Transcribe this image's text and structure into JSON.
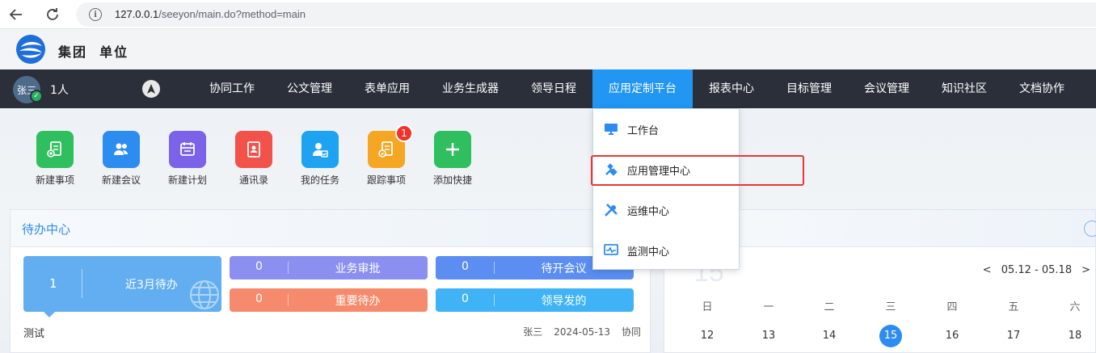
{
  "browser": {
    "url_host": "127.0.0.1",
    "url_path": "/seeyon/main.do?method=main"
  },
  "header": {
    "org_group": "集团",
    "org_unit": "单位"
  },
  "user": {
    "avatar_text": "张三",
    "online_count": "1人"
  },
  "nav": {
    "items": [
      "协同工作",
      "公文管理",
      "表单应用",
      "业务生成器",
      "领导日程",
      "应用定制平台",
      "报表中心",
      "目标管理",
      "会议管理",
      "知识社区",
      "文档协作"
    ],
    "active": "应用定制平台"
  },
  "dropdown": {
    "items": [
      "工作台",
      "应用管理中心",
      "运维中心",
      "监测中心"
    ],
    "highlighted": "应用管理中心"
  },
  "quick_actions": [
    {
      "label": "新建事项",
      "color": "#2fbf5f"
    },
    {
      "label": "新建会议",
      "color": "#2d8cf0"
    },
    {
      "label": "新建计划",
      "color": "#7b62e8"
    },
    {
      "label": "通讯录",
      "color": "#f2524a"
    },
    {
      "label": "我的任务",
      "color": "#1ea3f2"
    },
    {
      "label": "跟踪事项",
      "color": "#f5a623",
      "badge": "1"
    },
    {
      "label": "添加快捷",
      "color": "#2fbf5f"
    }
  ],
  "todo": {
    "title": "待办中心",
    "big_stat": {
      "count": "1",
      "label": "近3月待办"
    },
    "stats": [
      {
        "count": "0",
        "label": "业务审批",
        "color": "#8b8ff0"
      },
      {
        "count": "0",
        "label": "待开会议",
        "color": "#5b8ef0"
      },
      {
        "count": "0",
        "label": "重要待办",
        "color": "#f58b6c"
      },
      {
        "count": "0",
        "label": "领导发的",
        "color": "#3fb3f5"
      }
    ],
    "row": {
      "title": "测试",
      "sender": "张三",
      "date": "2024-05-13",
      "type": "协同"
    }
  },
  "calendar": {
    "big_day": "15",
    "prev": "<",
    "range": "05.12 - 05.18",
    "next": ">",
    "weekdays": [
      "日",
      "一",
      "二",
      "三",
      "四",
      "五",
      "六"
    ],
    "days": [
      "12",
      "13",
      "14",
      "15",
      "16",
      "17",
      "18"
    ],
    "today": "15"
  }
}
